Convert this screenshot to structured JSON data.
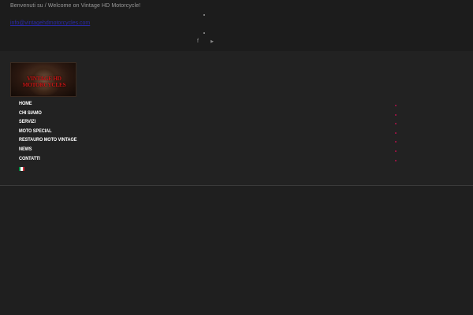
{
  "topbar": {
    "welcome_text": "Benvenuti su / Welcome on Vintage HD Motorcycle!",
    "email": "info@vintagehdmotorcycles.com",
    "social": [
      {
        "icon": "facebook-icon",
        "glyph": "f"
      },
      {
        "icon": "youtube-icon",
        "glyph": "▶"
      }
    ]
  },
  "logo": {
    "text": "VINTAGE HD MOTORCYCLES"
  },
  "nav": {
    "items": [
      {
        "label": "HOME"
      },
      {
        "label": "CHI SIAMO"
      },
      {
        "label": "SERVIZI"
      },
      {
        "label": "MOTO SPECIAL"
      },
      {
        "label": "RESTAURO MOTO VINTAGE"
      },
      {
        "label": "NEWS"
      },
      {
        "label": "CONTATTI"
      }
    ],
    "language_flag": "italian-flag-icon"
  },
  "colors": {
    "page_bg": "#1e1e1e",
    "nav_text": "#ffffff",
    "accent_dot": "#b0134a",
    "email_link": "#2a2aa8",
    "logo_text": "#c81414"
  }
}
